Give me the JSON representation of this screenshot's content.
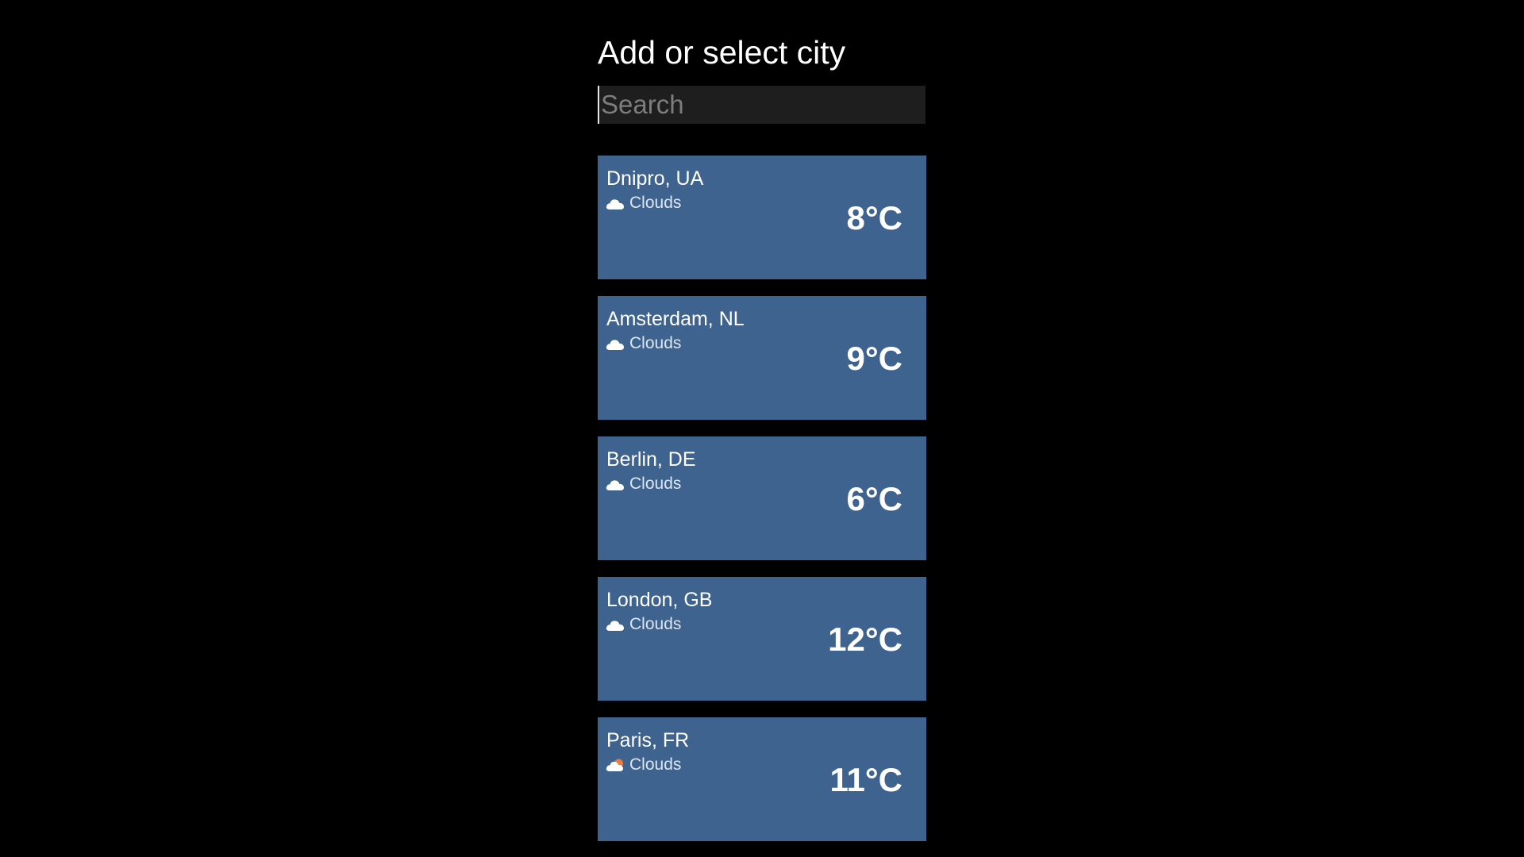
{
  "header": {
    "title": "Add or select city"
  },
  "search": {
    "placeholder": "Search",
    "value": ""
  },
  "colors": {
    "background": "#000000",
    "card": "#3e638e",
    "search_bg": "#1e1e1e"
  },
  "cities": [
    {
      "name": "Dnipro, UA",
      "condition": "Clouds",
      "temp": "8°C",
      "icon": "cloud-icon"
    },
    {
      "name": "Amsterdam, NL",
      "condition": "Clouds",
      "temp": "9°C",
      "icon": "cloud-icon"
    },
    {
      "name": "Berlin, DE",
      "condition": "Clouds",
      "temp": "6°C",
      "icon": "cloud-icon"
    },
    {
      "name": "London, GB",
      "condition": "Clouds",
      "temp": "12°C",
      "icon": "cloud-icon"
    },
    {
      "name": "Paris, FR",
      "condition": "Clouds",
      "temp": "11°C",
      "icon": "cloud-sun-icon"
    }
  ]
}
